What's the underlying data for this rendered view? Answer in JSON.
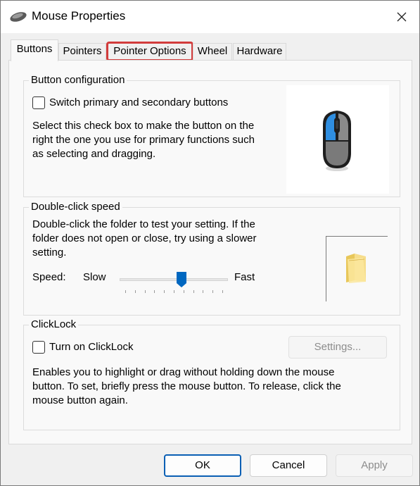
{
  "window": {
    "title": "Mouse Properties"
  },
  "tabs": [
    {
      "label": "Buttons"
    },
    {
      "label": "Pointers"
    },
    {
      "label": "Pointer Options"
    },
    {
      "label": "Wheel"
    },
    {
      "label": "Hardware"
    }
  ],
  "button_configuration": {
    "title": "Button configuration",
    "checkbox_label": "Switch primary and secondary buttons",
    "checked": false,
    "description_lines": [
      "Select this check box to make the button on the",
      "right the one you use for primary functions such",
      "as selecting and dragging."
    ]
  },
  "double_click": {
    "title": "Double-click speed",
    "description_lines": [
      "Double-click the folder to test your setting. If the",
      "folder does not open or close, try using a slower",
      "setting."
    ],
    "speed_label": "Speed:",
    "slow_label": "Slow",
    "fast_label": "Fast",
    "slider_value_fraction": 0.58,
    "tick_count": 11
  },
  "clicklock": {
    "title": "ClickLock",
    "checkbox_label": "Turn on ClickLock",
    "checked": false,
    "settings_label": "Settings...",
    "description_lines": [
      "Enables you to highlight or drag without holding down the mouse",
      "button. To set, briefly press the mouse button. To release, click the",
      "mouse button again."
    ]
  },
  "footer": {
    "ok_label": "OK",
    "cancel_label": "Cancel",
    "apply_label": "Apply"
  },
  "colors": {
    "highlight_border": "#d23c3c",
    "slider_thumb": "#0067c0",
    "default_button_border": "#0a5fb4"
  },
  "icons": {
    "title": "mouse-icon",
    "close": "close-icon",
    "mouse_image": "mouse-illustration",
    "folder": "folder-icon"
  }
}
